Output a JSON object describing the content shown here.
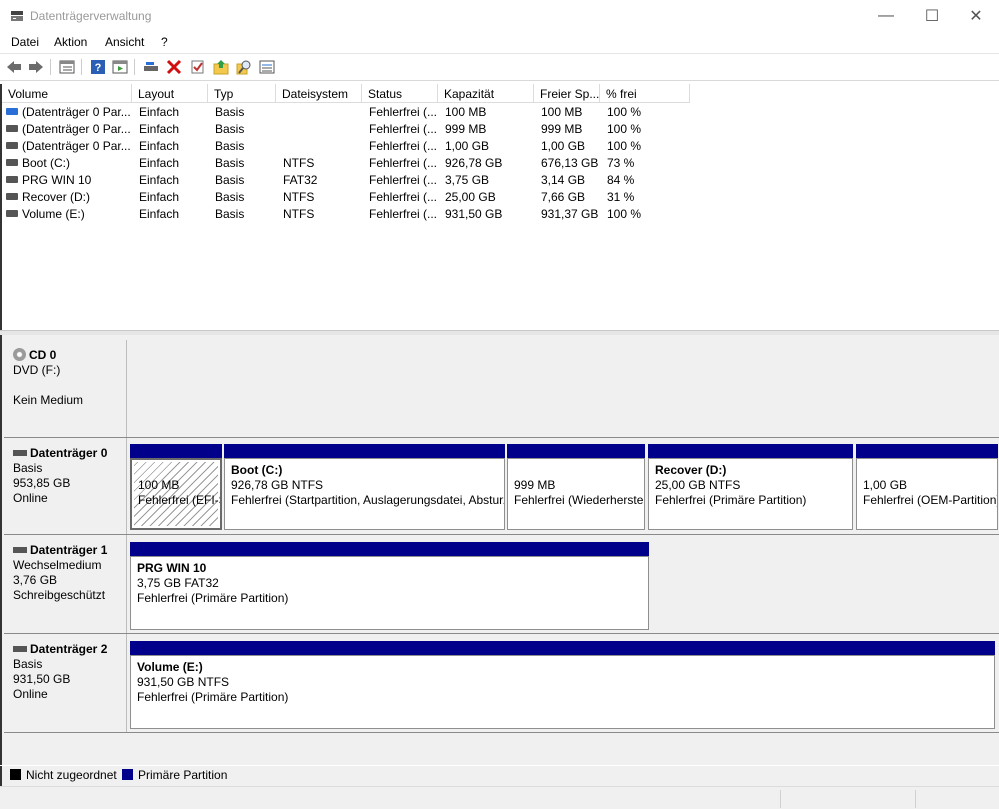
{
  "window": {
    "title": "Datenträgerverwaltung",
    "controls": {
      "minimize": "—",
      "maximize": "☐",
      "close": "✕"
    }
  },
  "menu": [
    "Datei",
    "Aktion",
    "Ansicht",
    "?"
  ],
  "toolbar": {
    "icons": [
      "back-icon",
      "forward-icon",
      "properties-view-icon",
      "help-icon",
      "console-view-icon",
      "connect-icon",
      "delete-icon",
      "check-icon",
      "folder-up-icon",
      "search-icon",
      "details-view-icon"
    ]
  },
  "table": {
    "columns": [
      "Volume",
      "Layout",
      "Typ",
      "Dateisystem",
      "Status",
      "Kapazität",
      "Freier Sp...",
      "% frei"
    ],
    "rows": [
      {
        "volume": "(Datenträger 0 Par...",
        "layout": "Einfach",
        "typ": "Basis",
        "fs": "",
        "status": "Fehlerfrei (...",
        "cap": "100 MB",
        "free": "100 MB",
        "pct": "100 %",
        "icon": "blue"
      },
      {
        "volume": "(Datenträger 0 Par...",
        "layout": "Einfach",
        "typ": "Basis",
        "fs": "",
        "status": "Fehlerfrei (...",
        "cap": "999 MB",
        "free": "999 MB",
        "pct": "100 %",
        "icon": "gray"
      },
      {
        "volume": "(Datenträger 0 Par...",
        "layout": "Einfach",
        "typ": "Basis",
        "fs": "",
        "status": "Fehlerfrei (...",
        "cap": "1,00 GB",
        "free": "1,00 GB",
        "pct": "100 %",
        "icon": "gray"
      },
      {
        "volume": "Boot (C:)",
        "layout": "Einfach",
        "typ": "Basis",
        "fs": "NTFS",
        "status": "Fehlerfrei (...",
        "cap": "926,78 GB",
        "free": "676,13 GB",
        "pct": "73 %",
        "icon": "gray"
      },
      {
        "volume": "PRG WIN 10",
        "layout": "Einfach",
        "typ": "Basis",
        "fs": "FAT32",
        "status": "Fehlerfrei (...",
        "cap": "3,75 GB",
        "free": "3,14 GB",
        "pct": "84 %",
        "icon": "gray"
      },
      {
        "volume": "Recover (D:)",
        "layout": "Einfach",
        "typ": "Basis",
        "fs": "NTFS",
        "status": "Fehlerfrei (...",
        "cap": "25,00 GB",
        "free": "7,66 GB",
        "pct": "31 %",
        "icon": "gray"
      },
      {
        "volume": "Volume (E:)",
        "layout": "Einfach",
        "typ": "Basis",
        "fs": "NTFS",
        "status": "Fehlerfrei (...",
        "cap": "931,50 GB",
        "free": "931,37 GB",
        "pct": "100 %",
        "icon": "gray"
      }
    ]
  },
  "disks": {
    "cd0": {
      "name": "CD 0",
      "line1": "DVD (F:)",
      "line2": "Kein Medium"
    },
    "disk0": {
      "name": "Datenträger 0",
      "type": "Basis",
      "size": "953,85 GB",
      "state": "Online",
      "partitions": [
        {
          "name": "",
          "size": "100 MB",
          "status": "Fehlerfrei (EFI-Systempartition)"
        },
        {
          "name": "Boot  (C:)",
          "size": "926,78 GB NTFS",
          "status": "Fehlerfrei (Startpartition, Auslagerungsdatei, Absturzspeicherabbild, Primäre Partition)"
        },
        {
          "name": "",
          "size": "999 MB",
          "status": "Fehlerfrei (Wiederherstellungspartition)"
        },
        {
          "name": "Recover  (D:)",
          "size": "25,00 GB NTFS",
          "status": "Fehlerfrei (Primäre Partition)"
        },
        {
          "name": "",
          "size": "1,00 GB",
          "status": "Fehlerfrei (OEM-Partition)"
        }
      ]
    },
    "disk1": {
      "name": "Datenträger 1",
      "type": "Wechselmedium",
      "size": "3,76 GB",
      "state": "Schreibgeschützt",
      "partitions": [
        {
          "name": "PRG WIN 10",
          "size": "3,75 GB FAT32",
          "status": "Fehlerfrei (Primäre Partition)"
        }
      ]
    },
    "disk2": {
      "name": "Datenträger 2",
      "type": "Basis",
      "size": "931,50 GB",
      "state": "Online",
      "partitions": [
        {
          "name": "Volume  (E:)",
          "size": "931,50 GB NTFS",
          "status": "Fehlerfrei (Primäre Partition)"
        }
      ]
    }
  },
  "legend": {
    "unallocated": "Nicht zugeordnet",
    "primary": "Primäre Partition",
    "colors": {
      "unallocated": "#000000",
      "primary": "#00008b"
    }
  }
}
